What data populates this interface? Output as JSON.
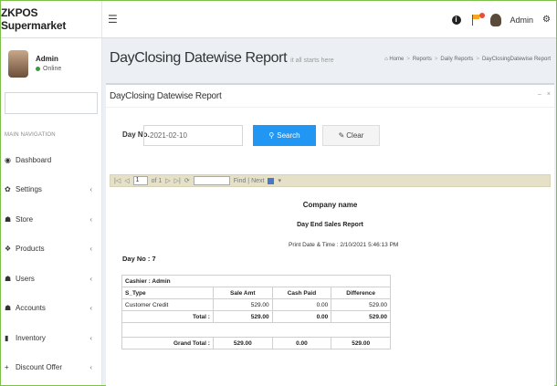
{
  "app": {
    "title": "ZKPOS Supermarket"
  },
  "header": {
    "menu_icon": "hamburger-icon",
    "user_label": "Admin",
    "icons": [
      "info-icon",
      "notification-flag-icon",
      "user-avatar-icon",
      "settings-gear-icon"
    ]
  },
  "sidebar": {
    "user_name": "Admin",
    "user_status": "Online",
    "nav_header": "MAIN NAVIGATION",
    "items": [
      {
        "label": "Dashboard",
        "icon": "dashboard-icon",
        "glyph": "◉",
        "has_children": false
      },
      {
        "label": "Settings",
        "icon": "gear-icon",
        "glyph": "✿",
        "has_children": true
      },
      {
        "label": "Store",
        "icon": "sitemap-icon",
        "glyph": "☗",
        "has_children": true
      },
      {
        "label": "Products",
        "icon": "tag-icon",
        "glyph": "❖",
        "has_children": true
      },
      {
        "label": "Users",
        "icon": "users-icon",
        "glyph": "☗",
        "has_children": true
      },
      {
        "label": "Accounts",
        "icon": "accounts-icon",
        "glyph": "☗",
        "has_children": true
      },
      {
        "label": "Inventory",
        "icon": "inventory-icon",
        "glyph": "▮",
        "has_children": true
      },
      {
        "label": "Discount Offer",
        "icon": "plus-icon",
        "glyph": "+",
        "has_children": true
      }
    ]
  },
  "page": {
    "title": "DayClosing Datewise Report",
    "subtitle": "it all starts here",
    "breadcrumb": [
      "Home",
      "Reports",
      "Daily Reports",
      "DayClosingDatewise Report"
    ]
  },
  "box": {
    "title": "DayClosing Datewise Report",
    "tools": [
      "–",
      "×"
    ]
  },
  "form": {
    "day_label": "Day No.",
    "day_value": "2021-02-10",
    "search_label": "Search",
    "clear_label": "Clear"
  },
  "viewer": {
    "page_value": "1",
    "of_text": "of 1",
    "find_next": "Find | Next"
  },
  "report": {
    "company": "Company name",
    "title": "Day End Sales Report",
    "print_date": "Print Date & Time : 2/10/2021 5:46:13 PM",
    "day_no": "Day No : 7",
    "cashier": "Cashier : Admin",
    "columns": [
      "S_Type",
      "Sale Amt",
      "Cash Paid",
      "Difference"
    ],
    "rows": [
      {
        "type": "Customer Credit",
        "sale": "529.00",
        "paid": "0.00",
        "diff": "529.00"
      }
    ],
    "total_label": "Total :",
    "total": {
      "sale": "529.00",
      "paid": "0.00",
      "diff": "529.00"
    },
    "grand_total_label": "Grand Total :",
    "grand_total": {
      "sale": "529.00",
      "paid": "0.00",
      "diff": "529.00"
    }
  }
}
